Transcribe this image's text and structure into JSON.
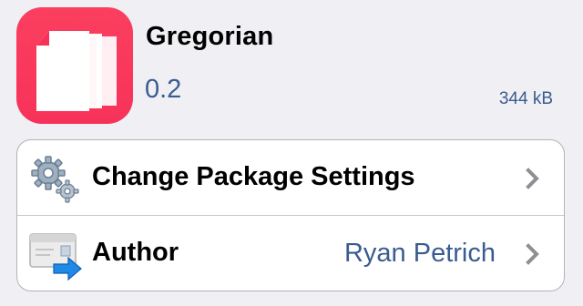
{
  "package": {
    "name": "Gregorian",
    "version": "0.2",
    "size": "344 kB",
    "icon": "gregorian-app-icon",
    "icon_color": "#f7325a"
  },
  "rows": [
    {
      "label": "Change Package Settings",
      "icon": "gears-icon",
      "detail": ""
    },
    {
      "label": "Author",
      "icon": "mail-author-icon",
      "detail": "Ryan Petrich"
    }
  ],
  "colors": {
    "background": "#efeff4",
    "accent_text": "#3a5c90",
    "chevron": "#8e8e93"
  }
}
